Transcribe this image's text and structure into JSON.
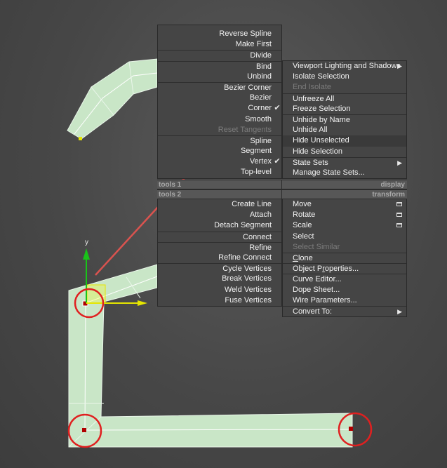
{
  "menu": {
    "tools1": {
      "left": [
        {
          "label": "Reverse Spline"
        },
        {
          "label": "Make First"
        },
        {
          "label": "Divide"
        },
        {
          "label": "Bind"
        },
        {
          "label": "Unbind"
        },
        {
          "label": "Bezier Corner"
        },
        {
          "label": "Bezier"
        },
        {
          "label": "Corner",
          "checked": true
        },
        {
          "label": "Smooth"
        },
        {
          "label": "Reset Tangents",
          "disabled": true
        },
        {
          "label": "Spline"
        },
        {
          "label": "Segment"
        },
        {
          "label": "Vertex",
          "checked": true
        },
        {
          "label": "Top-level"
        }
      ],
      "right": [
        {
          "label": "Viewport Lighting and Shadows",
          "submenu": true
        },
        {
          "label": "Isolate Selection"
        },
        {
          "label": "End Isolate",
          "disabled": true
        },
        {
          "label": "Unfreeze All"
        },
        {
          "label": "Freeze Selection"
        },
        {
          "label": "Unhide by Name"
        },
        {
          "label": "Unhide All"
        },
        {
          "label": "Hide Unselected",
          "highlighted": true
        },
        {
          "label": "Hide Selection"
        },
        {
          "label": "State Sets",
          "submenu": true
        },
        {
          "label": "Manage State Sets..."
        }
      ]
    },
    "headers": {
      "tools1": "tools 1",
      "display": "display",
      "tools2": "tools 2",
      "transform": "transform"
    },
    "tools2": {
      "left": [
        {
          "label": "Create Line"
        },
        {
          "label": "Attach"
        },
        {
          "label": "Detach Segment"
        },
        {
          "label": "Connect"
        },
        {
          "label": "Refine"
        },
        {
          "label": "Refine Connect"
        },
        {
          "label": "Cycle Vertices"
        },
        {
          "label": "Break Vertices"
        },
        {
          "label": "Weld Vertices"
        },
        {
          "label": "Fuse Vertices"
        }
      ],
      "right": [
        {
          "label": "Move",
          "settings": true
        },
        {
          "label": "Rotate",
          "settings": true
        },
        {
          "label": "Scale",
          "settings": true
        },
        {
          "label": "Select"
        },
        {
          "label": "Select Similar",
          "disabled": true
        },
        {
          "label": "Clone"
        },
        {
          "label": "Object Properties..."
        },
        {
          "label": "Curve Editor..."
        },
        {
          "label": "Dope Sheet..."
        },
        {
          "label": "Wire Parameters..."
        },
        {
          "label": "Convert To:",
          "submenu": true
        }
      ]
    }
  },
  "gizmo": {
    "y_axis_label": "y"
  },
  "colors": {
    "spline_fill": "#c9e6c7",
    "annotation_red": "#e02020",
    "arrow": "#d9534f",
    "menu_bg": "#454545"
  }
}
